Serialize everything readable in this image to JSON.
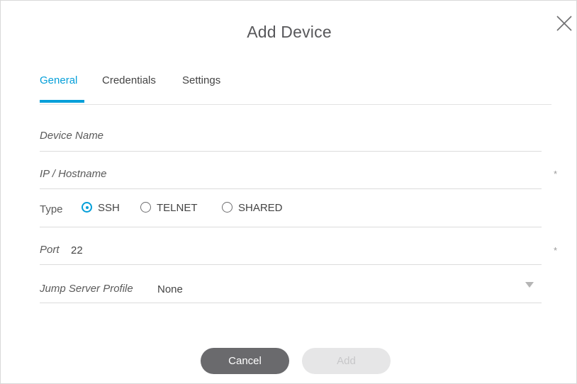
{
  "dialog": {
    "title": "Add Device",
    "close_icon": "close-icon"
  },
  "tabs": [
    {
      "label": "General",
      "active": true
    },
    {
      "label": "Credentials",
      "active": false
    },
    {
      "label": "Settings",
      "active": false
    }
  ],
  "form": {
    "device_name": {
      "placeholder": "Device Name",
      "value": ""
    },
    "ip_hostname": {
      "placeholder": "IP / Hostname",
      "value": "",
      "required_mark": "*"
    },
    "type": {
      "label": "Type",
      "options": [
        "SSH",
        "TELNET",
        "SHARED"
      ],
      "selected": "SSH"
    },
    "port": {
      "label": "Port",
      "value": "22",
      "required_mark": "*"
    },
    "jump_server_profile": {
      "label": "Jump Server Profile",
      "value": "None",
      "icon": "dropdown-arrow-icon"
    }
  },
  "buttons": {
    "cancel_label": "Cancel",
    "add_label": "Add",
    "add_enabled": false
  },
  "colors": {
    "accent": "#049fd9",
    "cancel_bg": "#6a6a6d",
    "add_disabled_bg": "#e6e6e7"
  }
}
